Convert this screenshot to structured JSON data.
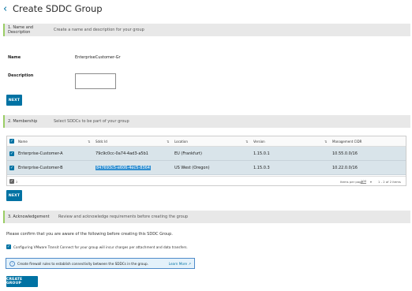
{
  "header": {
    "title": "Create SDDC Group"
  },
  "sections": {
    "name": {
      "title": "1. Name and Description",
      "subtitle": "Create a name and description for your group"
    },
    "membership": {
      "title": "2. Membership",
      "subtitle": "Select SDDCs to be part of your group"
    },
    "ack": {
      "title": "3. Acknowledgement",
      "subtitle": "Review and acknowledge requirements before creating the group"
    }
  },
  "form": {
    "name_label": "Name",
    "name_value": "EnterpriseCustomer-Gr",
    "description_label": "Description",
    "description_value": "",
    "next_label": "NEXT"
  },
  "grid": {
    "columns": [
      "Name",
      "Sddc Id",
      "Location",
      "Version",
      "Management CIDR"
    ],
    "rows": [
      {
        "name": "Enterprise-Customer-A",
        "sddc_id": "79c9c0cc-0a74-4ad3-a5b1",
        "location": "EU (Frankfurt)",
        "version": "1.15.0.1",
        "cidr": "10.55.0.0/16"
      },
      {
        "name": "Enterprise-Customer-B",
        "sddc_id": "847693c5-e606-4ec5-8364",
        "location": "US West (Oregon)",
        "version": "1.15.0.3",
        "cidr": "10.22.0.0/16"
      }
    ],
    "footer_count": "2",
    "items_per_page_label": "Items per page",
    "items_per_page_value": "100",
    "range_text": "1 - 2 of 2 items"
  },
  "membership_next_label": "NEXT",
  "ack": {
    "confirm_text": "Please confirm that you are aware of the following before creating this SDDC Group.",
    "check_text": "Configuring VMware Transit Connect for your group will incur charges per attachment and data transfers.",
    "info_text": "Create firewall rules to establish connectivity between the SDDCs in the group.",
    "learn_more": "Learn More",
    "create_label": "CREATE GROUP"
  },
  "colors": {
    "primary": "#0072a3",
    "accent": "#9acd65",
    "selected_row": "#d9e4ea"
  }
}
